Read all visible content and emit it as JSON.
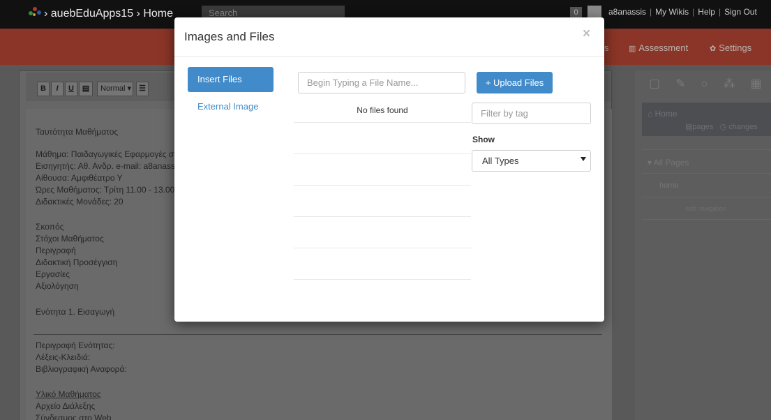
{
  "topbar": {
    "brand": "› auebEduApps15 › Home",
    "search_placeholder": "Search",
    "count": "0",
    "user": "a8anassis",
    "links": [
      "My Wikis",
      "Help",
      "Sign Out"
    ]
  },
  "navbar": {
    "fragment": "s",
    "assessment": "Assessment",
    "settings": "Settings"
  },
  "editor": {
    "toolbar": {
      "bold": "B",
      "italic": "I",
      "underline": "U",
      "format": "Normal"
    },
    "lines": [
      "Ταυτότητα Μαθήματος",
      "Μάθημα: Παιδαγωγικές Εφαρμογές στ",
      "Εισηγητής: Αθ. Ανδρ. e-mail: a8anass",
      "Αίθουσα: Αμφιθέατρο Υ",
      "Ώρες Μαθήματος: Τρίτη 11.00 - 13.00",
      "Διδακτικές Μονάδες: 20",
      "Σκοπός",
      "Στόχοι Μαθήματος",
      "Περιγραφή",
      "Διδακτική Προσέγγιση",
      "Εργασίες",
      "Αξιολόγηση",
      "Ενότητα 1. Εισαγωγή",
      "Περιγραφή Ενότητας:",
      "Λέξεις-Κλειδιά:",
      "Βιβλιογραφική Αναφορά:",
      "Υλικό Μαθήματος",
      "Αρχείο Διάλεξης",
      "Σύνδεσμος στο Web"
    ]
  },
  "sidebar": {
    "home_title": "Home",
    "pages_link": "pages",
    "changes_link": "changes",
    "all_pages": "All Pages",
    "home_item": "home",
    "edit_navigation": "edit navigation"
  },
  "modal": {
    "title": "Images and Files",
    "close": "×",
    "tabs": {
      "insert": "Insert Files",
      "external": "External Image"
    },
    "file_search_placeholder": "Begin Typing a File Name...",
    "upload_label": "+ Upload Files",
    "no_files": "No files found",
    "tag_filter_placeholder": "Filter by tag",
    "show_label": "Show",
    "type_select_value": "All Types"
  },
  "colors": {
    "primary": "#428bca",
    "nav": "#8a3527",
    "topbar": "#111111"
  }
}
